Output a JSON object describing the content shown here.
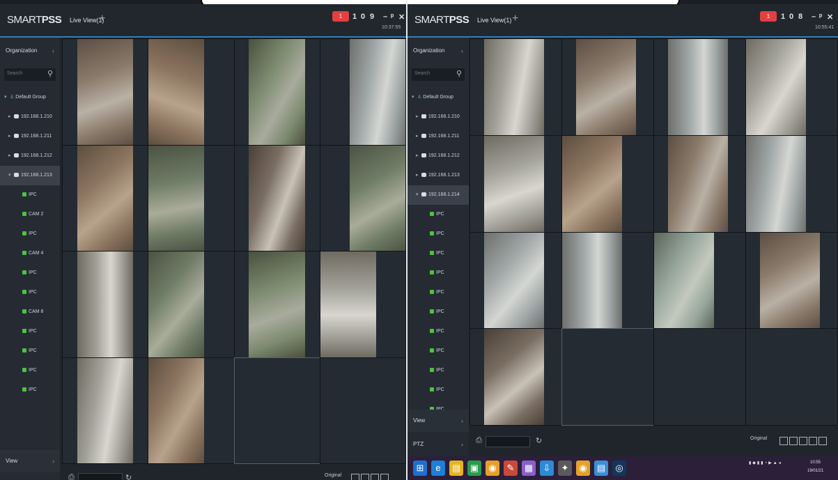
{
  "left": {
    "brand": {
      "light": "SMART",
      "bold": "PSS"
    },
    "tab_label": "Live View(1)",
    "add_tab": "+",
    "alarm_badge": "1",
    "top_buttons": [
      "1",
      "0",
      "9",
      "–",
      "ᵖ",
      "✕"
    ],
    "clock": "10:37:55",
    "sidebar": {
      "org_header": "Organization",
      "search_placeholder": "Search",
      "items": [
        {
          "label": "Default Group",
          "kind": "group"
        },
        {
          "label": "192.168.1.210",
          "kind": "device"
        },
        {
          "label": "192.168.1.211",
          "kind": "device"
        },
        {
          "label": "192.168.1.212",
          "kind": "device"
        },
        {
          "label": "192.168.1.213",
          "kind": "device",
          "selected": true
        },
        {
          "label": "IPC",
          "kind": "camera"
        },
        {
          "label": "CAM 2",
          "kind": "camera"
        },
        {
          "label": "IPC",
          "kind": "camera"
        },
        {
          "label": "CAM 4",
          "kind": "camera"
        },
        {
          "label": "IPC",
          "kind": "camera"
        },
        {
          "label": "IPC",
          "kind": "camera"
        },
        {
          "label": "CAM 8",
          "kind": "camera"
        },
        {
          "label": "IPC",
          "kind": "camera"
        },
        {
          "label": "IPC",
          "kind": "camera"
        },
        {
          "label": "IPC",
          "kind": "camera"
        },
        {
          "label": "IPC",
          "kind": "camera"
        }
      ],
      "view_footer": "View"
    },
    "bottom": {
      "stream": "Original"
    }
  },
  "right": {
    "brand": {
      "light": "SMART",
      "bold": "PSS"
    },
    "tab_label": "Live View(1)",
    "add_tab": "+",
    "alarm_badge": "1",
    "top_buttons": [
      "1",
      "0",
      "8",
      "–",
      "ᵖ",
      "✕"
    ],
    "clock": "10:55:41",
    "sidebar": {
      "org_header": "Organization",
      "search_placeholder": "Search",
      "items": [
        {
          "label": "Default Group",
          "kind": "group"
        },
        {
          "label": "192.168.1.210",
          "kind": "device"
        },
        {
          "label": "192.168.1.211",
          "kind": "device"
        },
        {
          "label": "192.168.1.212",
          "kind": "device"
        },
        {
          "label": "192.168.1.213",
          "kind": "device"
        },
        {
          "label": "192.168.1.214",
          "kind": "device",
          "selected": true
        },
        {
          "label": "IPC",
          "kind": "camera"
        },
        {
          "label": "IPC",
          "kind": "camera"
        },
        {
          "label": "IPC",
          "kind": "camera"
        },
        {
          "label": "IPC",
          "kind": "camera"
        },
        {
          "label": "IPC",
          "kind": "camera"
        },
        {
          "label": "IPC",
          "kind": "camera"
        },
        {
          "label": "IPC",
          "kind": "camera"
        },
        {
          "label": "IPC",
          "kind": "camera"
        },
        {
          "label": "IPC",
          "kind": "camera"
        },
        {
          "label": "IPC",
          "kind": "camera"
        },
        {
          "label": "IPC",
          "kind": "camera"
        }
      ],
      "view_footer": "View",
      "ptz_footer": "PTZ"
    },
    "bottom": {
      "stream": "Original"
    }
  },
  "taskbar": {
    "icons": [
      "windows-start-icon",
      "edge-browser-icon",
      "file-explorer-icon",
      "green-app-icon",
      "chrome-icon",
      "paint-icon",
      "photo-app-icon",
      "download-icon",
      "tool-icon",
      "chrome-icon-2",
      "folder-icon",
      "smartpss-icon"
    ],
    "tray_time": "10:55",
    "tray_date": "19/01/21"
  }
}
